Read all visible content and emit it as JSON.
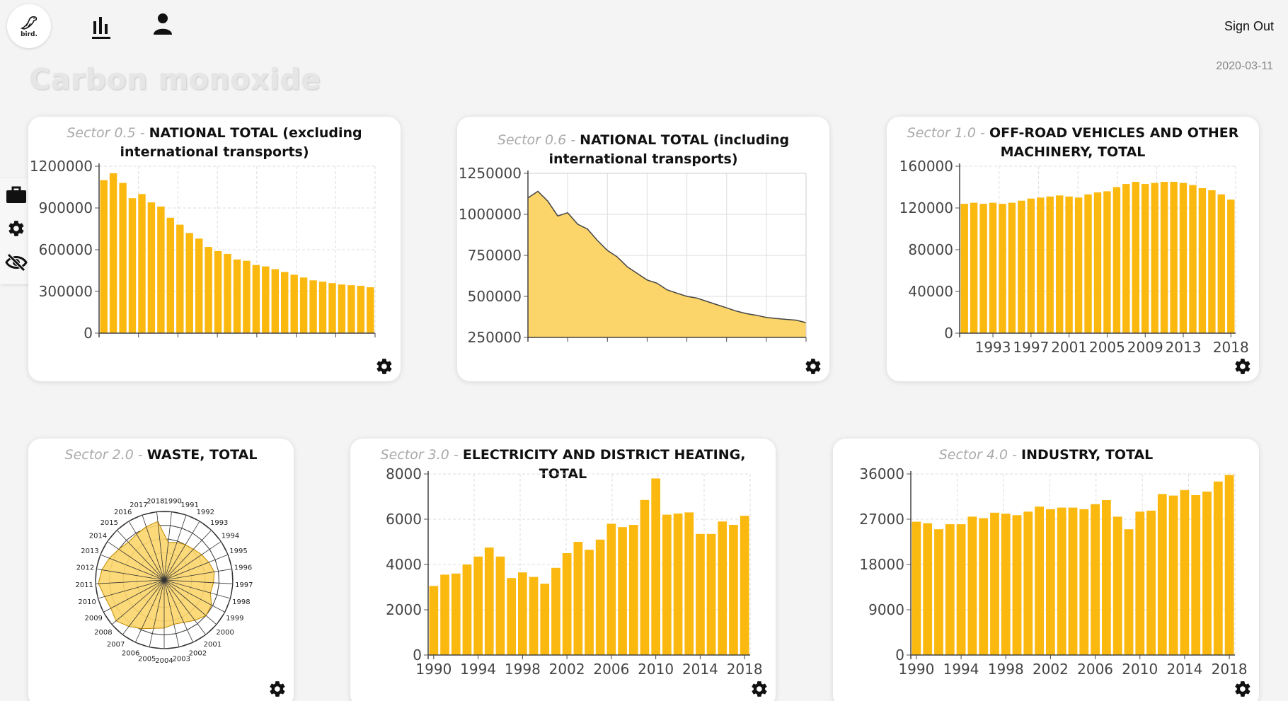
{
  "app": {
    "logo_text": "bird.",
    "signout_label": "Sign Out",
    "date": "2020-03-11",
    "page_title": "Carbon monoxide"
  },
  "colors": {
    "bar": "#fbb80f",
    "area": "#fcd56a",
    "accent": "#fbb80f"
  },
  "cards": [
    {
      "sector_label": "Sector 0.5 - ",
      "name_line1": "NATIONAL TOTAL (excluding",
      "name_line2": "international transports)"
    },
    {
      "sector_label": "Sector 0.6 - ",
      "name_line1": "NATIONAL TOTAL (including",
      "name_line2": "international transports)"
    },
    {
      "sector_label": "Sector 1.0 - ",
      "name_line1": "OFF-ROAD VEHICLES AND OTHER",
      "name_line2": "MACHINERY, TOTAL"
    },
    {
      "sector_label": "Sector 2.0 - ",
      "name_line1": "WASTE, TOTAL"
    },
    {
      "sector_label": "Sector 3.0 - ",
      "name_line1": "ELECTRICITY AND DISTRICT HEATING, TOTAL"
    },
    {
      "sector_label": "Sector 4.0 - ",
      "name_line1": "INDUSTRY, TOTAL"
    }
  ],
  "chart_data": [
    {
      "type": "bar",
      "x": [
        1990,
        1991,
        1992,
        1993,
        1994,
        1995,
        1996,
        1997,
        1998,
        1999,
        2000,
        2001,
        2002,
        2003,
        2004,
        2005,
        2006,
        2007,
        2008,
        2009,
        2010,
        2011,
        2012,
        2013,
        2014,
        2015,
        2016,
        2017,
        2018
      ],
      "values": [
        1100000,
        1150000,
        1080000,
        970000,
        1000000,
        940000,
        910000,
        830000,
        780000,
        720000,
        680000,
        620000,
        590000,
        570000,
        530000,
        520000,
        490000,
        480000,
        460000,
        440000,
        420000,
        400000,
        380000,
        370000,
        360000,
        350000,
        345000,
        340000,
        330000
      ],
      "yticks": [
        "0",
        "300000",
        "600000",
        "900000",
        "1200000"
      ],
      "ylim": [
        0,
        1200000
      ],
      "xticks": [],
      "grid": true
    },
    {
      "type": "area",
      "x": [
        1990,
        1991,
        1992,
        1993,
        1994,
        1995,
        1996,
        1997,
        1998,
        1999,
        2000,
        2001,
        2002,
        2003,
        2004,
        2005,
        2006,
        2007,
        2008,
        2009,
        2010,
        2011,
        2012,
        2013,
        2014,
        2015,
        2016,
        2017,
        2018
      ],
      "values": [
        1100000,
        1140000,
        1080000,
        990000,
        1010000,
        940000,
        910000,
        840000,
        780000,
        740000,
        680000,
        640000,
        600000,
        580000,
        540000,
        520000,
        500000,
        490000,
        470000,
        450000,
        430000,
        410000,
        395000,
        385000,
        372000,
        365000,
        360000,
        355000,
        340000
      ],
      "yticks": [
        "250000",
        "500000",
        "750000",
        "1000000",
        "1250000"
      ],
      "ylim": [
        250000,
        1250000
      ],
      "xticks": [],
      "grid": true
    },
    {
      "type": "bar",
      "x": [
        1990,
        1991,
        1992,
        1993,
        1994,
        1995,
        1996,
        1997,
        1998,
        1999,
        2000,
        2001,
        2002,
        2003,
        2004,
        2005,
        2006,
        2007,
        2008,
        2009,
        2010,
        2011,
        2012,
        2013,
        2014,
        2015,
        2016,
        2017,
        2018
      ],
      "values": [
        124000,
        125000,
        124000,
        125000,
        124000,
        125000,
        127000,
        129000,
        130000,
        131000,
        132000,
        131000,
        130000,
        133000,
        135000,
        136000,
        140000,
        143000,
        145000,
        143000,
        144000,
        145000,
        145000,
        144000,
        142000,
        139000,
        137000,
        133000,
        128000
      ],
      "yticks": [
        "0",
        "40000",
        "80000",
        "120000",
        "160000"
      ],
      "ylim": [
        0,
        160000
      ],
      "xticks": [
        "1993",
        "1997",
        "2001",
        "2005",
        "2009",
        "2013",
        "2018"
      ],
      "grid": true
    },
    {
      "type": "radar",
      "categories": [
        "1990",
        "1991",
        "1992",
        "1993",
        "1994",
        "1995",
        "1996",
        "1997",
        "1998",
        "1999",
        "2000",
        "2001",
        "2002",
        "2003",
        "2004",
        "2005",
        "2006",
        "2007",
        "2008",
        "2009",
        "2010",
        "2011",
        "2012",
        "2013",
        "2014",
        "2015",
        "2016",
        "2017",
        "2018"
      ],
      "values": [
        0.55,
        0.58,
        0.6,
        0.62,
        0.66,
        0.7,
        0.74,
        0.72,
        0.7,
        0.78,
        0.8,
        0.74,
        0.68,
        0.66,
        0.7,
        0.72,
        0.78,
        0.85,
        0.92,
        0.88,
        0.9,
        0.96,
        0.92,
        0.86,
        0.8,
        0.76,
        0.78,
        0.82,
        0.86
      ]
    },
    {
      "type": "bar",
      "x": [
        1990,
        1991,
        1992,
        1993,
        1994,
        1995,
        1996,
        1997,
        1998,
        1999,
        2000,
        2001,
        2002,
        2003,
        2004,
        2005,
        2006,
        2007,
        2008,
        2009,
        2010,
        2011,
        2012,
        2013,
        2014,
        2015,
        2016,
        2017,
        2018
      ],
      "values": [
        3050,
        3550,
        3600,
        4000,
        4350,
        4750,
        4350,
        3400,
        3650,
        3450,
        3150,
        3850,
        4500,
        5000,
        4650,
        5100,
        5800,
        5650,
        5750,
        6850,
        7800,
        6200,
        6250,
        6300,
        5350,
        5350,
        5900,
        5750,
        6150
      ],
      "yticks": [
        "0",
        "2000",
        "4000",
        "6000",
        "8000"
      ],
      "ylim": [
        0,
        8000
      ],
      "xticks": [
        "1990",
        "1994",
        "1998",
        "2002",
        "2006",
        "2010",
        "2014",
        "2018"
      ],
      "grid": true
    },
    {
      "type": "bar",
      "x": [
        1990,
        1991,
        1992,
        1993,
        1994,
        1995,
        1996,
        1997,
        1998,
        1999,
        2000,
        2001,
        2002,
        2003,
        2004,
        2005,
        2006,
        2007,
        2008,
        2009,
        2010,
        2011,
        2012,
        2013,
        2014,
        2015,
        2016,
        2017,
        2018
      ],
      "values": [
        26500,
        26200,
        25000,
        26000,
        26000,
        27500,
        27200,
        28300,
        28100,
        27800,
        28500,
        29500,
        29000,
        29300,
        29300,
        29000,
        30000,
        30800,
        27500,
        25000,
        28500,
        28700,
        32000,
        31700,
        32800,
        31800,
        32500,
        34500,
        35800
      ],
      "yticks": [
        "0",
        "9000",
        "18000",
        "27000",
        "36000"
      ],
      "ylim": [
        0,
        36000
      ],
      "xticks": [
        "1990",
        "1994",
        "1998",
        "2002",
        "2006",
        "2010",
        "2014",
        "2018"
      ],
      "grid": true
    }
  ]
}
